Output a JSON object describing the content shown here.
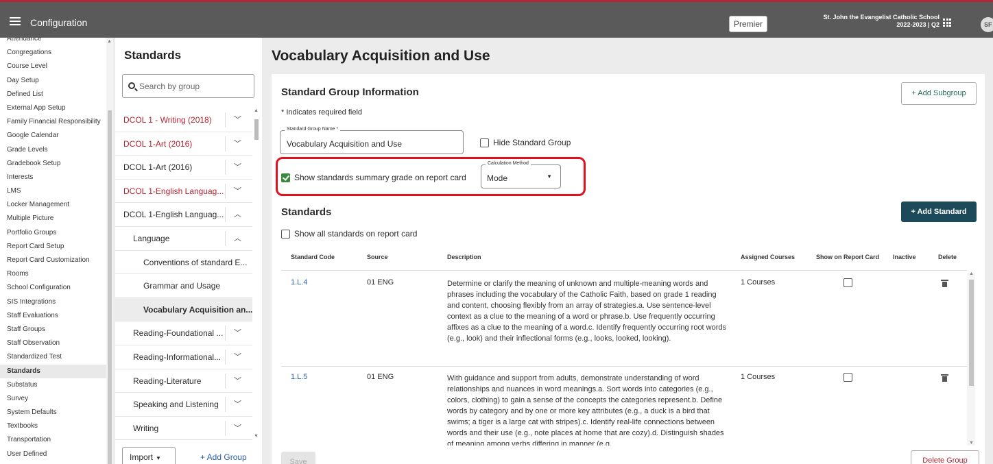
{
  "topbar": {
    "app_title": "Configuration",
    "premier_label": "Premier",
    "school_name": "St. John the Evangelist Catholic School",
    "term": "2022-2023 | Q2",
    "avatar_initials": "SF",
    "accent_color": "#b0283a"
  },
  "leftnav": {
    "items": [
      "Attendance",
      "Congregations",
      "Course Level",
      "Day Setup",
      "Defined List",
      "External App Setup",
      "Family Financial Responsibility",
      "Google Calendar",
      "Grade Levels",
      "Gradebook Setup",
      "Interests",
      "LMS",
      "Locker Management",
      "Multiple Picture",
      "Portfolio Groups",
      "Report Card Setup",
      "Report Card Customization",
      "Rooms",
      "School Configuration",
      "SIS Integrations",
      "Staff Evaluations",
      "Staff Groups",
      "Staff Observation",
      "Standardized Test",
      "Standards",
      "Substatus",
      "Survey",
      "System Defaults",
      "Textbooks",
      "Transportation",
      "User Defined"
    ],
    "active": "Standards"
  },
  "standards_panel": {
    "title": "Standards",
    "search_placeholder": "Search by group",
    "tree": [
      {
        "label": "DCOL 1 - Writing (2018)",
        "level": 1,
        "red": true,
        "chevron": "down"
      },
      {
        "label": "DCOL 1-Art (2016)",
        "level": 1,
        "red": true,
        "chevron": "down"
      },
      {
        "label": "DCOL 1-Art (2016)",
        "level": 1,
        "red": false,
        "chevron": "down"
      },
      {
        "label": "DCOL 1-English Languag...",
        "level": 1,
        "red": true,
        "chevron": "down"
      },
      {
        "label": "DCOL 1-English Languag...",
        "level": 1,
        "red": false,
        "chevron": "up"
      },
      {
        "label": "Language",
        "level": 2,
        "red": false,
        "chevron": "up"
      },
      {
        "label": "Conventions of standard E...",
        "level": 3,
        "red": false,
        "chevron": ""
      },
      {
        "label": "Grammar and Usage",
        "level": 3,
        "red": false,
        "chevron": ""
      },
      {
        "label": "Vocabulary Acquisition an...",
        "level": 3,
        "red": false,
        "chevron": "",
        "selected": true
      },
      {
        "label": "Reading-Foundational ...",
        "level": 2,
        "red": false,
        "chevron": "down"
      },
      {
        "label": "Reading-Informational...",
        "level": 2,
        "red": false,
        "chevron": "down"
      },
      {
        "label": "Reading-Literature",
        "level": 2,
        "red": false,
        "chevron": "down"
      },
      {
        "label": "Speaking and Listening",
        "level": 2,
        "red": false,
        "chevron": "down"
      },
      {
        "label": "Writing",
        "level": 2,
        "red": false,
        "chevron": "down"
      }
    ],
    "import_label": "Import",
    "add_group_label": "+ Add Group"
  },
  "main": {
    "page_title": "Vocabulary Acquisition and Use",
    "section_title": "Standard Group Information",
    "add_subgroup_label": "+ Add Subgroup",
    "required_note": "* Indicates required field",
    "group_name_label": "Standard Group Name *",
    "group_name_value": "Vocabulary Acquisition and Use",
    "hide_group_label": "Hide Standard Group",
    "hide_group_checked": false,
    "show_summary_label": "Show standards summary grade on report card",
    "show_summary_checked": true,
    "calc_method_label": "Calculation Method",
    "calc_method_value": "Mode",
    "standards_title": "Standards",
    "add_standard_label": "+ Add Standard",
    "show_all_label": "Show all standards on report card",
    "columns": [
      "Standard Code",
      "Source",
      "Description",
      "Assigned Courses",
      "Show on Report Card",
      "Inactive",
      "Delete"
    ],
    "rows": [
      {
        "code": "1.L.4",
        "source": "01 ENG",
        "description": "Determine or clarify the meaning of unknown and multiple-meaning words and phrases including the vocabulary of the Catholic Faith, based on grade 1 reading and content, choosing flexibly from an array of strategies.a. Use sentence-level context as a clue to the meaning of a word or phrase.b. Use frequently occurring affixes as a clue to the meaning of a word.c. Identify frequently occurring root words (e.g., look) and their inflectional forms (e.g., looks, looked, looking).",
        "courses": "1 Courses"
      },
      {
        "code": "1.L.5",
        "source": "01 ENG",
        "description": "With guidance and support from adults, demonstrate understanding of word relationships and nuances in word meanings.a. Sort words into categories (e.g., colors, clothing) to gain a sense of the concepts the categories represent.b. Define words by category and by one or more key attributes (e.g., a duck is a bird that swims; a tiger is a large cat with stripes).c. Identify real-life connections between words and their use (e.g., note places at home that are cozy).d. Distinguish shades of meaning among verbs differing in manner (e.g.",
        "courses": "1 Courses"
      }
    ],
    "save_label": "Save",
    "delete_group_label": "Delete Group"
  }
}
